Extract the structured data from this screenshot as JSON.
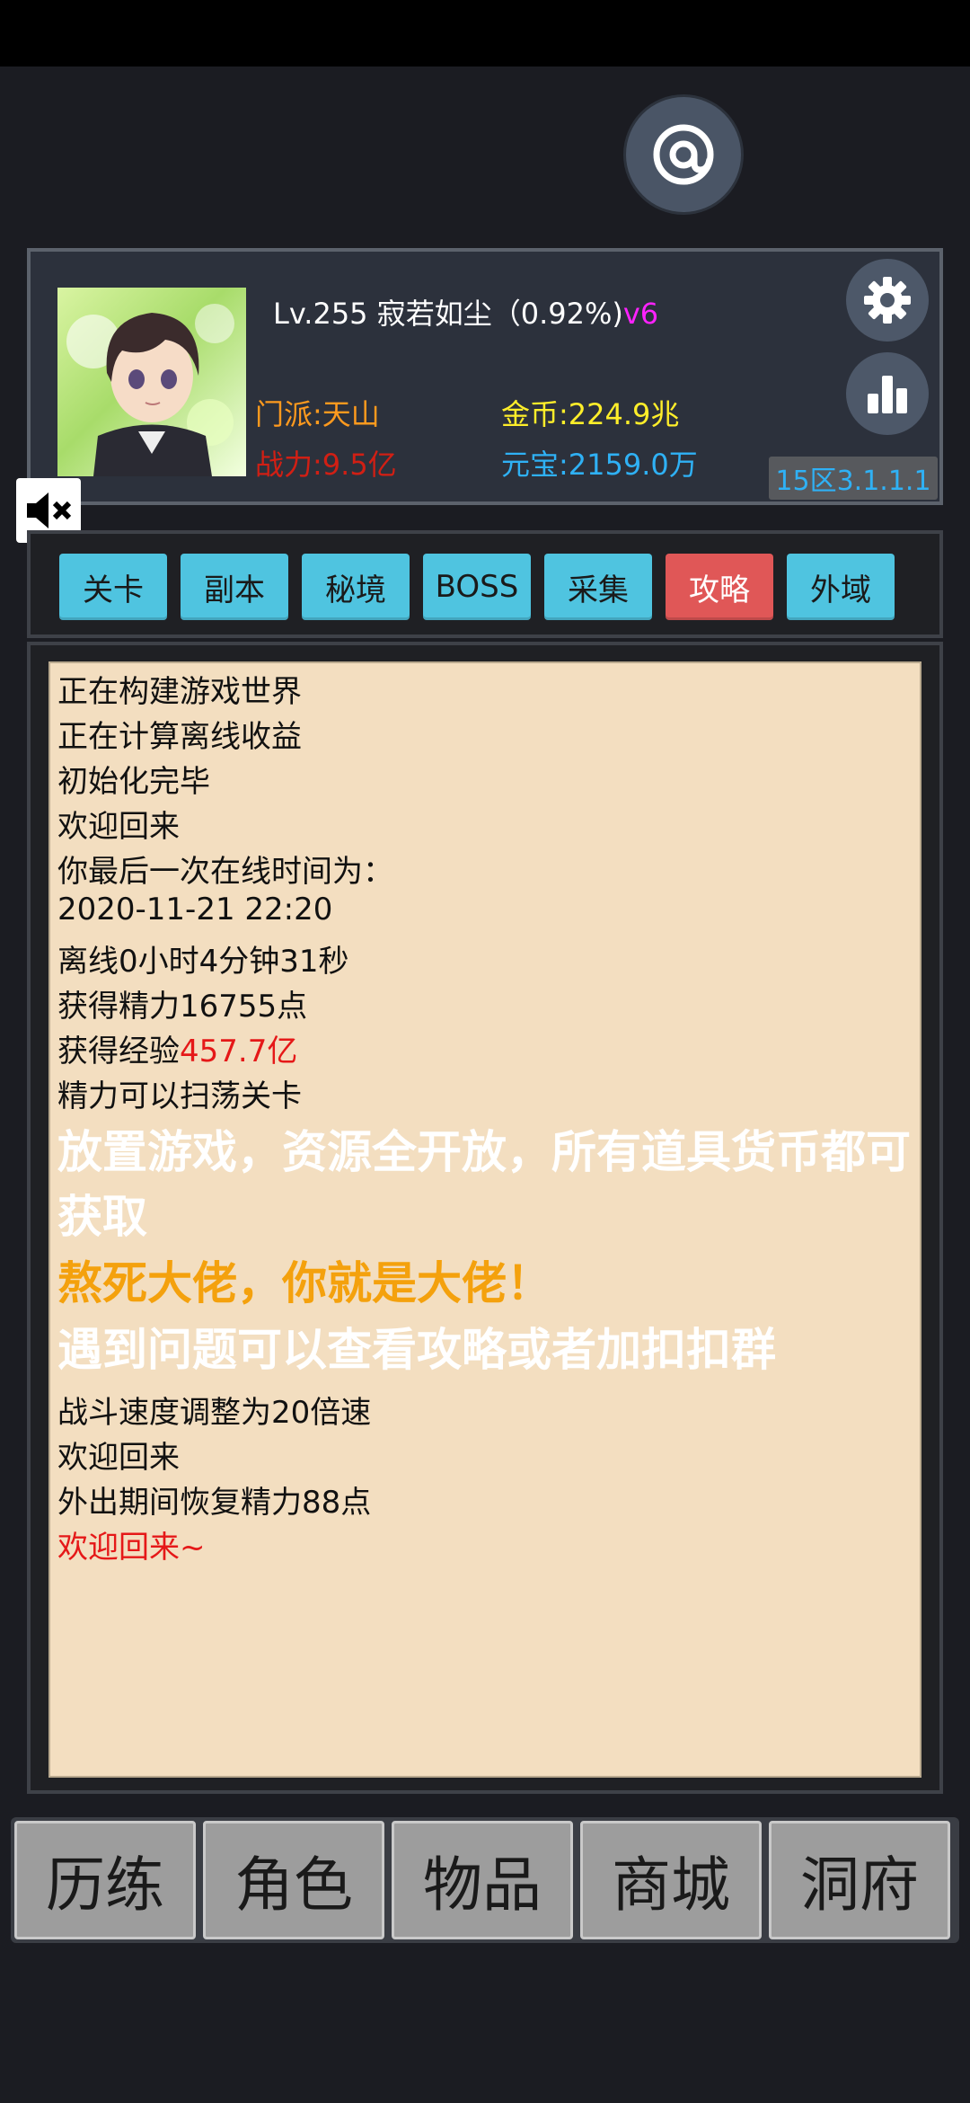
{
  "player": {
    "level_name": "Lv.255  寂若如尘（0.92%)",
    "vip": "v6",
    "sect": "门派:天山",
    "gold": "金币:224.9兆",
    "power": "战力:9.5亿",
    "yuanbao": "元宝:2159.0万",
    "server": "15区3.1.1.1"
  },
  "tabs": [
    "关卡",
    "副本",
    "秘境",
    "BOSS",
    "采集",
    "攻略",
    "外域"
  ],
  "active_tab": "攻略",
  "log": {
    "l1": "正在构建游戏世界",
    "l2": "正在计算离线收益",
    "l3": "初始化完毕",
    "l4": "欢迎回来",
    "l5": "你最后一次在线时间为：",
    "l6": "2020-11-21 22:20",
    "l7": "离线0小时4分钟31秒",
    "l8": "获得精力16755点",
    "l9_prefix": "获得经验",
    "l9_value": "457.7亿",
    "l10": "精力可以扫荡关卡",
    "l11a": "放置游戏，资源全开放，所有道具货币都可",
    "l11b": "获取",
    "l12": "熬死大佬，你就是大佬！",
    "l13": "遇到问题可以查看攻略或者加扣扣群",
    "l14": "战斗速度调整为20倍速",
    "l15": "欢迎回来",
    "l16": "外出期间恢复精力88点",
    "l17": "欢迎回来~"
  },
  "bottom_nav": [
    "历练",
    "角色",
    "物品",
    "商城",
    "洞府"
  ],
  "colors": {
    "accent_tab": "#4fc4e0",
    "active_tab": "#e05757",
    "gold": "#ffee2a",
    "sect": "#ff9a1e",
    "power": "#d11f14",
    "yuanbao": "#2fb1f5",
    "vip": "#ff22ff",
    "log_bg": "#f3dec0"
  },
  "icons": [
    "at-icon",
    "gear-icon",
    "bar-chart-icon",
    "mute-speaker-icon"
  ]
}
